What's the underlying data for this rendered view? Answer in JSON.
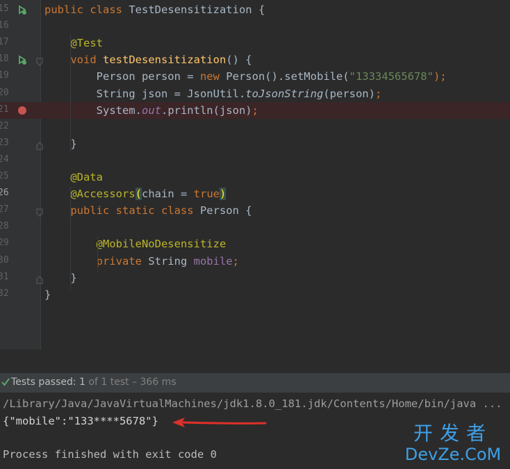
{
  "editor": {
    "lines": [
      {
        "num": "15",
        "tokens": [
          {
            "t": "public class ",
            "c": "kw"
          },
          {
            "t": "TestDesensitization {",
            "c": ""
          }
        ],
        "icon": "run"
      },
      {
        "num": "16",
        "tokens": []
      },
      {
        "num": "17",
        "tokens": [
          {
            "t": "    @Test",
            "c": "ann"
          }
        ]
      },
      {
        "num": "18",
        "tokens": [
          {
            "t": "    void ",
            "c": "kw"
          },
          {
            "t": "testDesensitization",
            "c": "fn"
          },
          {
            "t": "() {",
            "c": ""
          }
        ],
        "icon": "run"
      },
      {
        "num": "19",
        "tokens": [
          {
            "t": "        Person person = ",
            "c": ""
          },
          {
            "t": "new ",
            "c": "kw"
          },
          {
            "t": "Person().setMobile(",
            "c": ""
          },
          {
            "t": "\"13334565678\"",
            "c": "str"
          },
          {
            "t": ");",
            "c": "kw"
          }
        ]
      },
      {
        "num": "20",
        "tokens": [
          {
            "t": "        String json = JsonUtil.",
            "c": ""
          },
          {
            "t": "toJsonString",
            "c": "it"
          },
          {
            "t": "(person)",
            "c": ""
          },
          {
            "t": ";",
            "c": "kw"
          }
        ]
      },
      {
        "num": "21",
        "tokens": [
          {
            "t": "        System.",
            "c": ""
          },
          {
            "t": "out",
            "c": "fld it"
          },
          {
            "t": ".println(json)",
            "c": ""
          },
          {
            "t": ";",
            "c": "kw"
          }
        ],
        "breakpoint": true
      },
      {
        "num": "22",
        "tokens": []
      },
      {
        "num": "23",
        "tokens": [
          {
            "t": "    }",
            "c": ""
          }
        ]
      },
      {
        "num": "24",
        "tokens": []
      },
      {
        "num": "25",
        "tokens": [
          {
            "t": "    @Data",
            "c": "ann"
          }
        ]
      },
      {
        "num": "26",
        "tokens": [
          {
            "t": "    @Accessors",
            "c": "ann"
          },
          {
            "t": "(",
            "c": "paren-hl"
          },
          {
            "t": "chain = ",
            "c": ""
          },
          {
            "t": "true",
            "c": "kw"
          },
          {
            "t": ")",
            "c": "paren-hl"
          }
        ],
        "current": true
      },
      {
        "num": "27",
        "tokens": [
          {
            "t": "    public static class ",
            "c": "kw"
          },
          {
            "t": "Person {",
            "c": ""
          }
        ]
      },
      {
        "num": "28",
        "tokens": []
      },
      {
        "num": "29",
        "tokens": [
          {
            "t": "        @MobileNoDesensitize",
            "c": "ann"
          }
        ]
      },
      {
        "num": "30",
        "tokens": [
          {
            "t": "        private ",
            "c": "kw"
          },
          {
            "t": "String ",
            "c": ""
          },
          {
            "t": "mobile",
            "c": "fld"
          },
          {
            "t": ";",
            "c": "kw"
          }
        ]
      },
      {
        "num": "31",
        "tokens": [
          {
            "t": "    }",
            "c": ""
          }
        ]
      },
      {
        "num": "32",
        "tokens": [
          {
            "t": "}",
            "c": ""
          }
        ]
      }
    ]
  },
  "test_bar": {
    "status": "Tests passed: ",
    "count": "1",
    "detail": " of 1 test – 366 ms"
  },
  "console": {
    "command": "/Library/Java/JavaVirtualMachines/jdk1.8.0_181.jdk/Contents/Home/bin/java ...",
    "output": "{\"mobile\":\"133****5678\"}",
    "exit": "Process finished with exit code 0"
  },
  "watermark": {
    "cn": "开发者",
    "en": "DevZe.CoM"
  },
  "colors": {
    "background": "#2b2b2b",
    "keyword": "#cc7832",
    "annotation": "#bbb529",
    "string": "#6a8759",
    "field": "#9876aa",
    "method": "#ffc66d",
    "breakpoint": "#c75450",
    "arrow": "#e0302a",
    "watermark": "#3ea0e8"
  }
}
